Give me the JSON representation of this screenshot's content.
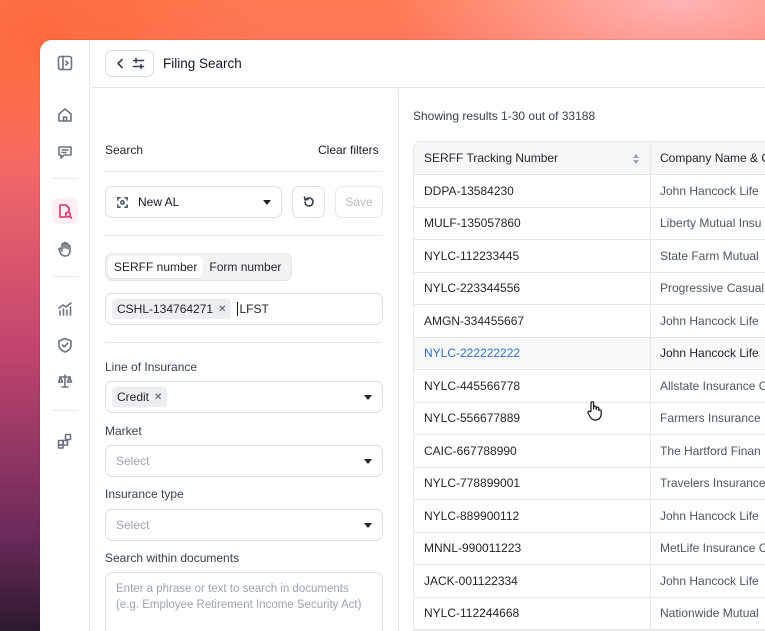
{
  "header": {
    "title": "Filing Search"
  },
  "filters": {
    "search_label": "Search",
    "clear_label": "Clear filters",
    "saved_search": "New AL",
    "save_label": "Save",
    "toggle": {
      "option_a": "SERFF number",
      "option_b": "Form number"
    },
    "serff_chip": "CSHL-134764271",
    "serff_typed": "LFST",
    "line_of_insurance": {
      "label": "Line of Insurance",
      "chip": "Credit"
    },
    "market": {
      "label": "Market",
      "placeholder": "Select"
    },
    "insurance_type": {
      "label": "Insurance type",
      "placeholder": "Select"
    },
    "documents": {
      "label": "Search within documents",
      "placeholder": "Enter a phrase or text to search in documents (e.g. Employee Retirement Income Security Act)"
    }
  },
  "results": {
    "count_text": "Showing results 1-30 out of 33188",
    "columns": [
      "SERFF Tracking Number",
      "Company Name & C"
    ],
    "rows": [
      [
        "DDPA-13584230",
        "John Hancock Life"
      ],
      [
        "MULF-135057860",
        "Liberty Mutual Insu"
      ],
      [
        "NYLC-112233445",
        "State Farm Mutual"
      ],
      [
        "NYLC-223344556",
        "Progressive Casual"
      ],
      [
        "AMGN-334455667",
        "John Hancock Life"
      ],
      [
        "NYLC-222222222",
        "John Hancock Life"
      ],
      [
        "NYLC-445566778",
        "Allstate Insurance C"
      ],
      [
        "NYLC-556677889",
        "Farmers Insurance"
      ],
      [
        "CAIC-667788990",
        "The Hartford Finan"
      ],
      [
        "NYLC-778899001",
        "Travelers Insurance"
      ],
      [
        "NYLC-889900112",
        "John Hancock Life"
      ],
      [
        "MNNL-990011223",
        "MetLife Insurance C"
      ],
      [
        "JACK-001122334",
        "John Hancock Life"
      ],
      [
        "NYLC-112244668",
        "Nationwide Mutual"
      ]
    ]
  }
}
